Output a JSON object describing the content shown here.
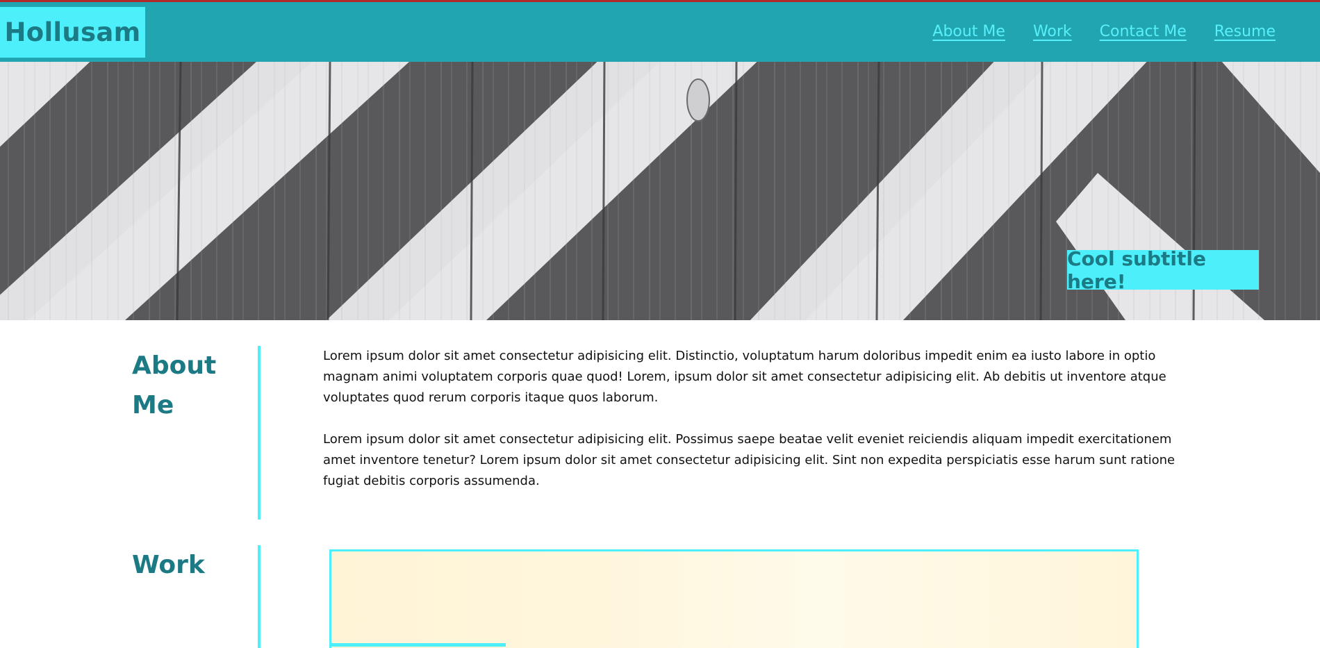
{
  "brand": {
    "logo": "Hollusam"
  },
  "nav": {
    "items": [
      {
        "label": "About Me"
      },
      {
        "label": "Work"
      },
      {
        "label": "Contact Me"
      },
      {
        "label": "Resume"
      }
    ]
  },
  "hero": {
    "subtitle": "Cool subtitle here!"
  },
  "about": {
    "title": "About Me",
    "paragraphs": [
      "Lorem ipsum dolor sit amet consectetur adipisicing elit. Distinctio, voluptatum harum doloribus impedit enim ea iusto labore in optio magnam animi voluptatem corporis quae quod! Lorem, ipsum dolor sit amet consectetur adipisicing elit. Ab debitis ut inventore atque voluptates quod rerum corporis itaque quos laborum.",
      "Lorem ipsum dolor sit amet consectetur adipisicing elit. Possimus saepe beatae velit eveniet reiciendis aliquam impedit exercitationem amet inventore tenetur? Lorem ipsum dolor sit amet consectetur adipisicing elit. Sint non expedita perspiciatis esse harum sunt ratione fugiat debitis corporis assumenda."
    ]
  },
  "work": {
    "title": "Work"
  },
  "colors": {
    "navbar": "#21a5b1",
    "accent": "#4deffa",
    "heading": "#1c7a85",
    "nav_link": "#57f0fb"
  },
  "icons": {
    "hero_background": "striped-wood-image"
  }
}
